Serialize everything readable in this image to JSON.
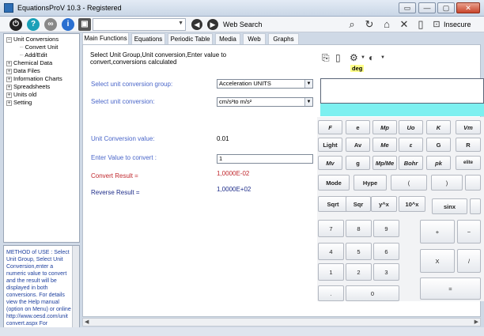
{
  "window": {
    "title": "EquationsProV 10.3 - Registered",
    "min": "▭",
    "restore": "—",
    "max": "▢",
    "close": "✕"
  },
  "toolbar": {
    "combo_value": "",
    "web_search": "Web Search",
    "insecure": "Insecure"
  },
  "tree": {
    "items": [
      {
        "pm": "−",
        "label": "Unit Conversions"
      },
      {
        "label": "Convert Unit"
      },
      {
        "label": "Add/Edit"
      },
      {
        "pm": "+",
        "label": "Chemical Data"
      },
      {
        "pm": "+",
        "label": "Data Files"
      },
      {
        "pm": "+",
        "label": "Information Charts"
      },
      {
        "pm": "+",
        "label": "Spreadsheets"
      },
      {
        "pm": "+",
        "label": "Units old"
      },
      {
        "pm": "+",
        "label": "Setting"
      }
    ]
  },
  "method_text": "METHOD of USE : Select Unit Group, Select Unit Conversion,enter a numeric value to convert and the result will be displayed in both conversions. For details view the Help manual (option on Menu) or online http://www.oesd.com/unit convert.aspx For",
  "tabs": [
    "Main Functions",
    "Equations",
    "Periodic Table",
    "Media",
    "Web",
    "Graphs"
  ],
  "main": {
    "instructions": "Select Unit Group,Unit conversion,Enter value to convert,conversions calculated",
    "group_label": "Select unit conversion group:",
    "group_value": "Acceleration UNITS",
    "conv_label": "Select unit conversion:",
    "conv_value": "cm/s²to  m/s²",
    "unit_value_label": "Unit Conversion value:",
    "unit_value": "0.01",
    "enter_label": "Enter Value to convert :",
    "enter_value": "1",
    "convert_label": "Convert Result =",
    "convert_value": "1,0000E-02",
    "reverse_label": "Reverse Result =",
    "reverse_value": "1,0000E+02"
  },
  "calc": {
    "deg": "deg",
    "row1": [
      "F",
      "e",
      "Mp",
      "Uo",
      "K",
      "Vm"
    ],
    "row2": [
      "Light",
      "Av",
      "Me",
      "ε",
      "G",
      "R"
    ],
    "row3": [
      "Mv",
      "g",
      "Mp/Me",
      "Bohr",
      "pk",
      "elite"
    ],
    "row4": [
      "Mode",
      "Hype",
      "(",
      ")"
    ],
    "row5": [
      "Sqrt",
      "Sqr",
      "y^x",
      "10^x",
      "sinx"
    ],
    "nums": [
      "7",
      "8",
      "9",
      "4",
      "5",
      "6",
      "1",
      "2",
      "3",
      ".",
      "0"
    ],
    "ops": [
      "+",
      "−",
      "X",
      "/",
      "="
    ]
  },
  "colors": {
    "accent_blue": "#4a66c9",
    "result_red": "#c0282d",
    "result_navy": "#1f2e8a",
    "cyan": "#7df0f0"
  }
}
